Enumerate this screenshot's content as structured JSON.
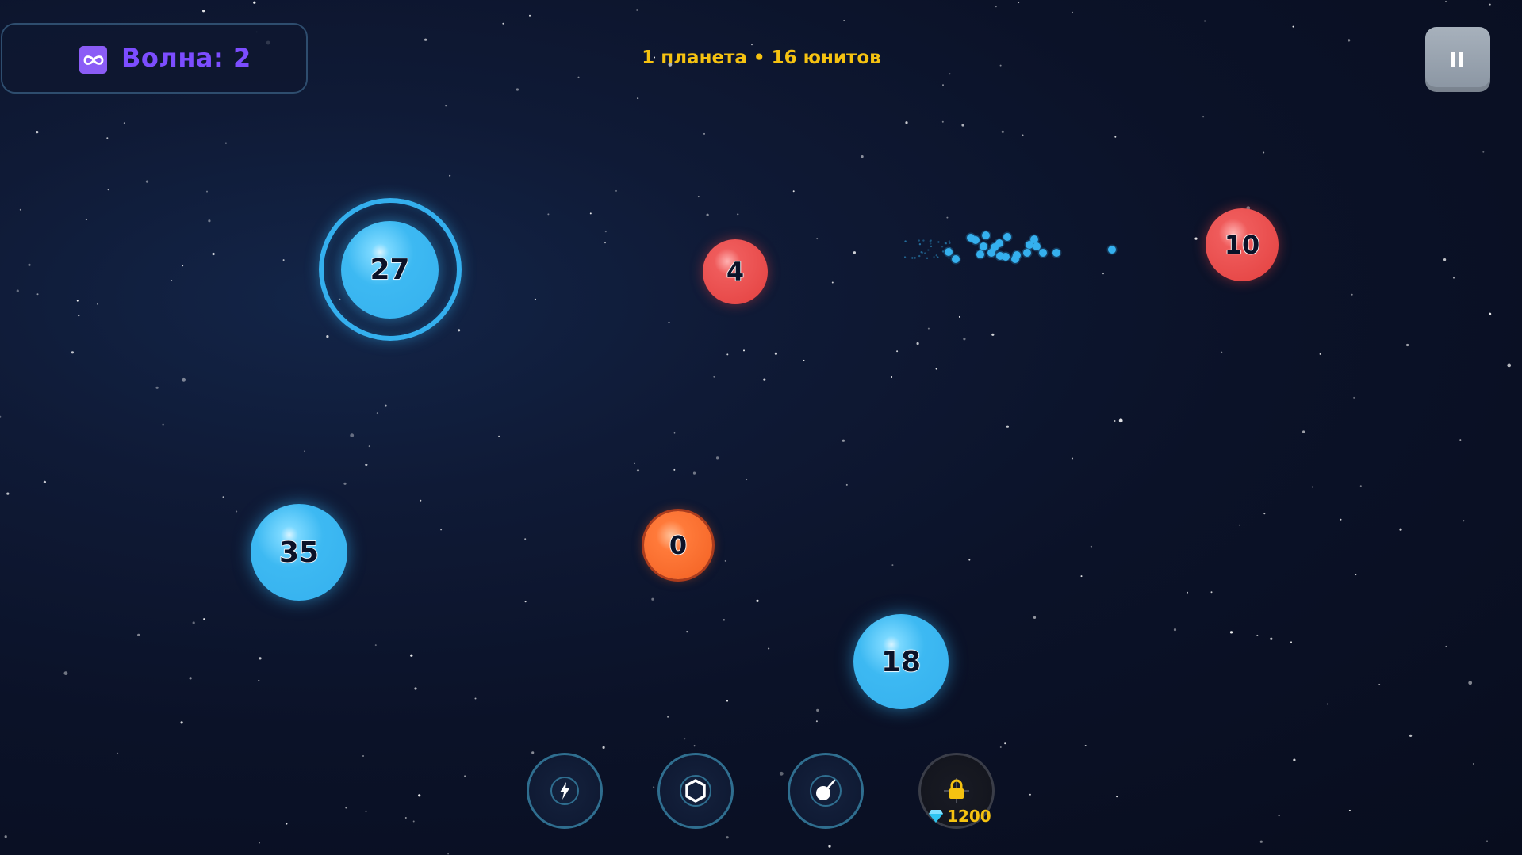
{
  "hud": {
    "wave_label": "Волна: 2",
    "status": "1 планета • 16 юнитов"
  },
  "planets": [
    {
      "id": "p27",
      "owner": "player",
      "units": "27",
      "selected": true
    },
    {
      "id": "p4",
      "owner": "enemy",
      "units": "4",
      "selected": false
    },
    {
      "id": "p10",
      "owner": "enemy",
      "units": "10",
      "selected": false
    },
    {
      "id": "p35",
      "owner": "player",
      "units": "35",
      "selected": false
    },
    {
      "id": "p0",
      "owner": "neutral",
      "units": "0",
      "selected": false
    },
    {
      "id": "p18",
      "owner": "player",
      "units": "18",
      "selected": false
    }
  ],
  "abilities": [
    {
      "id": "lightning",
      "icon": "lightning-icon",
      "locked": false
    },
    {
      "id": "shield",
      "icon": "shield-hexagon-icon",
      "locked": false
    },
    {
      "id": "bomb",
      "icon": "bomb-icon",
      "locked": false
    },
    {
      "id": "locked",
      "icon": "lock-icon",
      "locked": true,
      "price": "1200"
    }
  ],
  "colors": {
    "player": "#35b0ee",
    "enemy": "#e3403f",
    "neutral": "#f26022",
    "wave_text": "#7c4dff",
    "status_text": "#f5c211",
    "gem": "#2ec4f0"
  }
}
